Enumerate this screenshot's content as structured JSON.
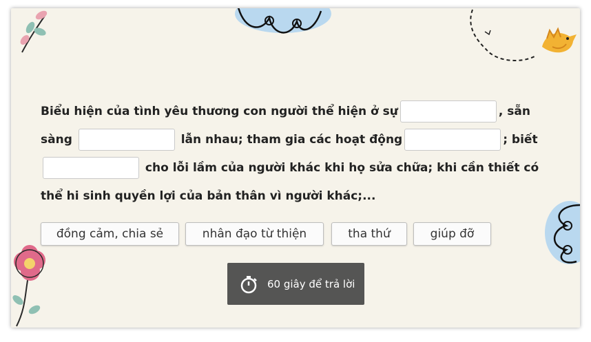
{
  "question": {
    "segments": [
      "Biểu hiện của tình yêu thương con người thể hiện ở sự",
      ", sẵn sàng",
      "lẫn nhau; tham gia các hoạt động",
      "; biết",
      "cho lỗi lầm của người khác khi họ sửa chữa; khi cần thiết có thể hi sinh quyền lợi của bản thân vì người khác;..."
    ]
  },
  "options": [
    {
      "label": "đồng cảm, chia sẻ"
    },
    {
      "label": "nhân đạo từ thiện"
    },
    {
      "label": "tha thứ"
    },
    {
      "label": "giúp đỡ"
    }
  ],
  "timer": {
    "label": "60 giây để trả lời",
    "icon": "stopwatch-icon"
  },
  "colors": {
    "background": "#f6f3ea",
    "timer_bg": "#555554",
    "blue": "#b9d8ef",
    "pink": "#e06a8a",
    "yellow": "#f2b233"
  }
}
